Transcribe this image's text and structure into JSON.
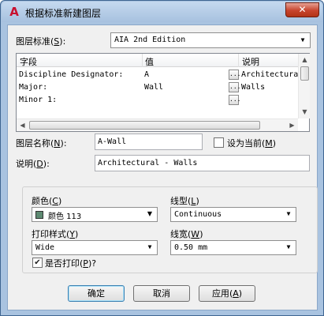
{
  "window": {
    "title": "根据标准新建图层",
    "close_glyph": "✕",
    "app_icon_glyph": "A"
  },
  "layer_standard": {
    "label": "图层标准",
    "hotkey": "S",
    "value": "AIA 2nd Edition"
  },
  "table": {
    "headers": [
      "字段",
      "值",
      "说明"
    ],
    "rows": [
      {
        "field": "Discipline Designator:",
        "value": "A",
        "desc": "Architectura"
      },
      {
        "field": "Major:",
        "value": "Wall",
        "desc": "Walls"
      },
      {
        "field": "Minor 1:",
        "value": "",
        "desc": ""
      }
    ],
    "ellipsis": "..."
  },
  "layer_name": {
    "label": "图层名称",
    "hotkey": "N",
    "value": "A-Wall"
  },
  "set_current": {
    "label": "设为当前",
    "hotkey": "M",
    "checked": false
  },
  "description": {
    "label": "说明",
    "hotkey": "D",
    "value": "Architectural - Walls"
  },
  "color": {
    "label": "颜色",
    "hotkey": "C",
    "value": "颜色 113",
    "swatch_hex": "#5e8a72"
  },
  "linetype": {
    "label": "线型",
    "hotkey": "L",
    "value": "Continuous"
  },
  "plot_style": {
    "label": "打印样式",
    "hotkey": "Y",
    "value": "Wide"
  },
  "lineweight": {
    "label": "线宽",
    "hotkey": "W",
    "value": "0.50 mm"
  },
  "plot": {
    "label": "是否打印",
    "hotkey": "P",
    "suffix": "?",
    "checked": true
  },
  "buttons": {
    "ok": "确定",
    "cancel": "取消",
    "apply": "应用",
    "apply_hotkey": "A"
  }
}
